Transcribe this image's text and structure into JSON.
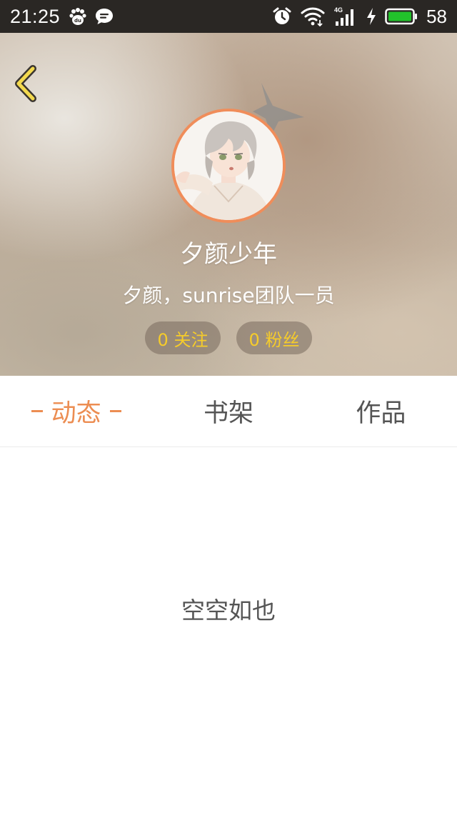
{
  "status_bar": {
    "time": "21:25",
    "battery_level": "58",
    "network_label": "4G",
    "left_icons": [
      "baidu-paw-icon",
      "chat-bubble-icon"
    ],
    "right_icons": [
      "alarm-clock-icon",
      "wifi-icon",
      "cellular-signal-icon",
      "charging-bolt-icon",
      "battery-icon"
    ],
    "battery_fill_color": "#22c22b"
  },
  "profile": {
    "back_icon": "chevron-left-icon",
    "name": "夕颜少年",
    "bio": "夕颜，sunrise团队一员",
    "avatar_border_color": "#f08d5a",
    "stats": {
      "following": "0 关注",
      "followers": "0 粉丝"
    }
  },
  "tabs": {
    "active_index": 0,
    "accent_color": "#ec8d52",
    "items": [
      {
        "label": "动态"
      },
      {
        "label": "书架"
      },
      {
        "label": "作品"
      }
    ]
  },
  "content": {
    "empty_message": "空空如也"
  }
}
